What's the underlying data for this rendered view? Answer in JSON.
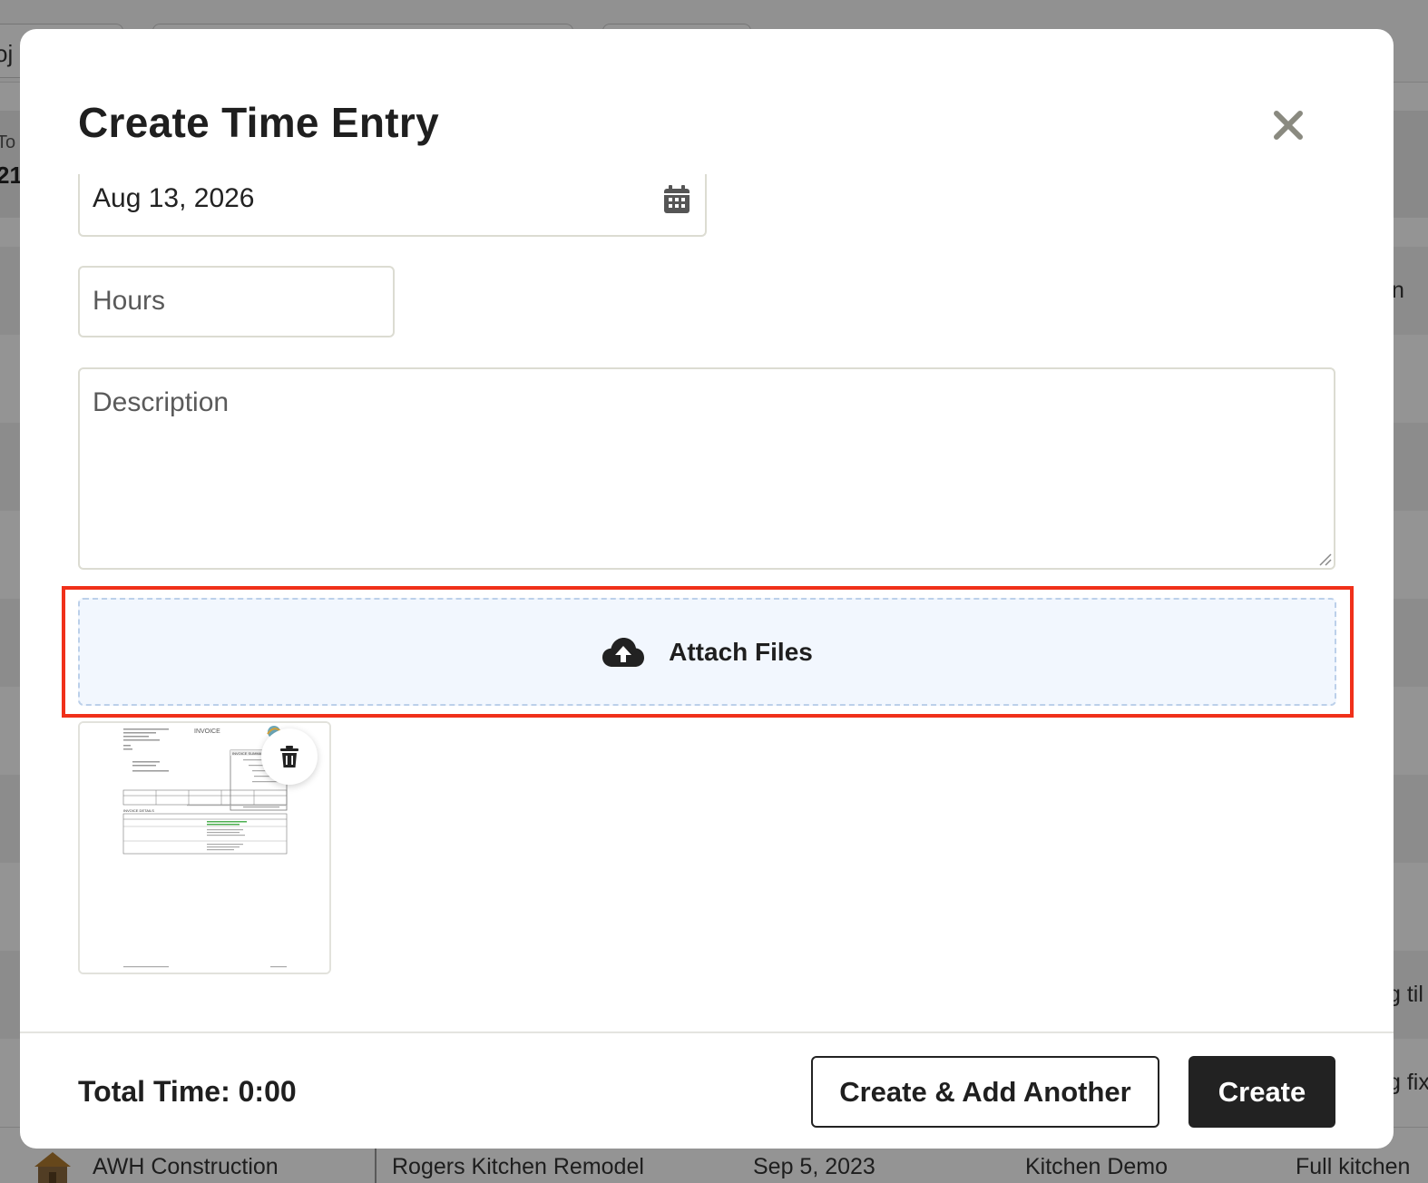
{
  "modal": {
    "title": "Create Time Entry",
    "date_value": "Aug 13, 2026",
    "hours_placeholder": "Hours",
    "description_placeholder": "Description",
    "attach_label": "Attach Files",
    "total_time": "Total Time: 0:00",
    "create_add_another_label": "Create & Add Another",
    "create_label": "Create"
  },
  "attachment": {
    "doc_title": "INVOICE",
    "doc_section_summary": "INVOICE SUMMARY",
    "doc_section_details": "INVOICE DETAILS"
  },
  "background": {
    "top_partial": "oj",
    "summary_label": "To",
    "summary_value": "21",
    "row_partials": [
      "n",
      "g til",
      "g fix"
    ],
    "last_row": {
      "company": "AWH Construction",
      "project": "Rogers Kitchen Remodel",
      "date": "Sep 5, 2023",
      "task": "Kitchen Demo",
      "description": "Full kitchen"
    }
  },
  "colors": {
    "highlight": "#f0301a",
    "attach_bg": "#f2f7fe",
    "primary_button": "#222222"
  }
}
